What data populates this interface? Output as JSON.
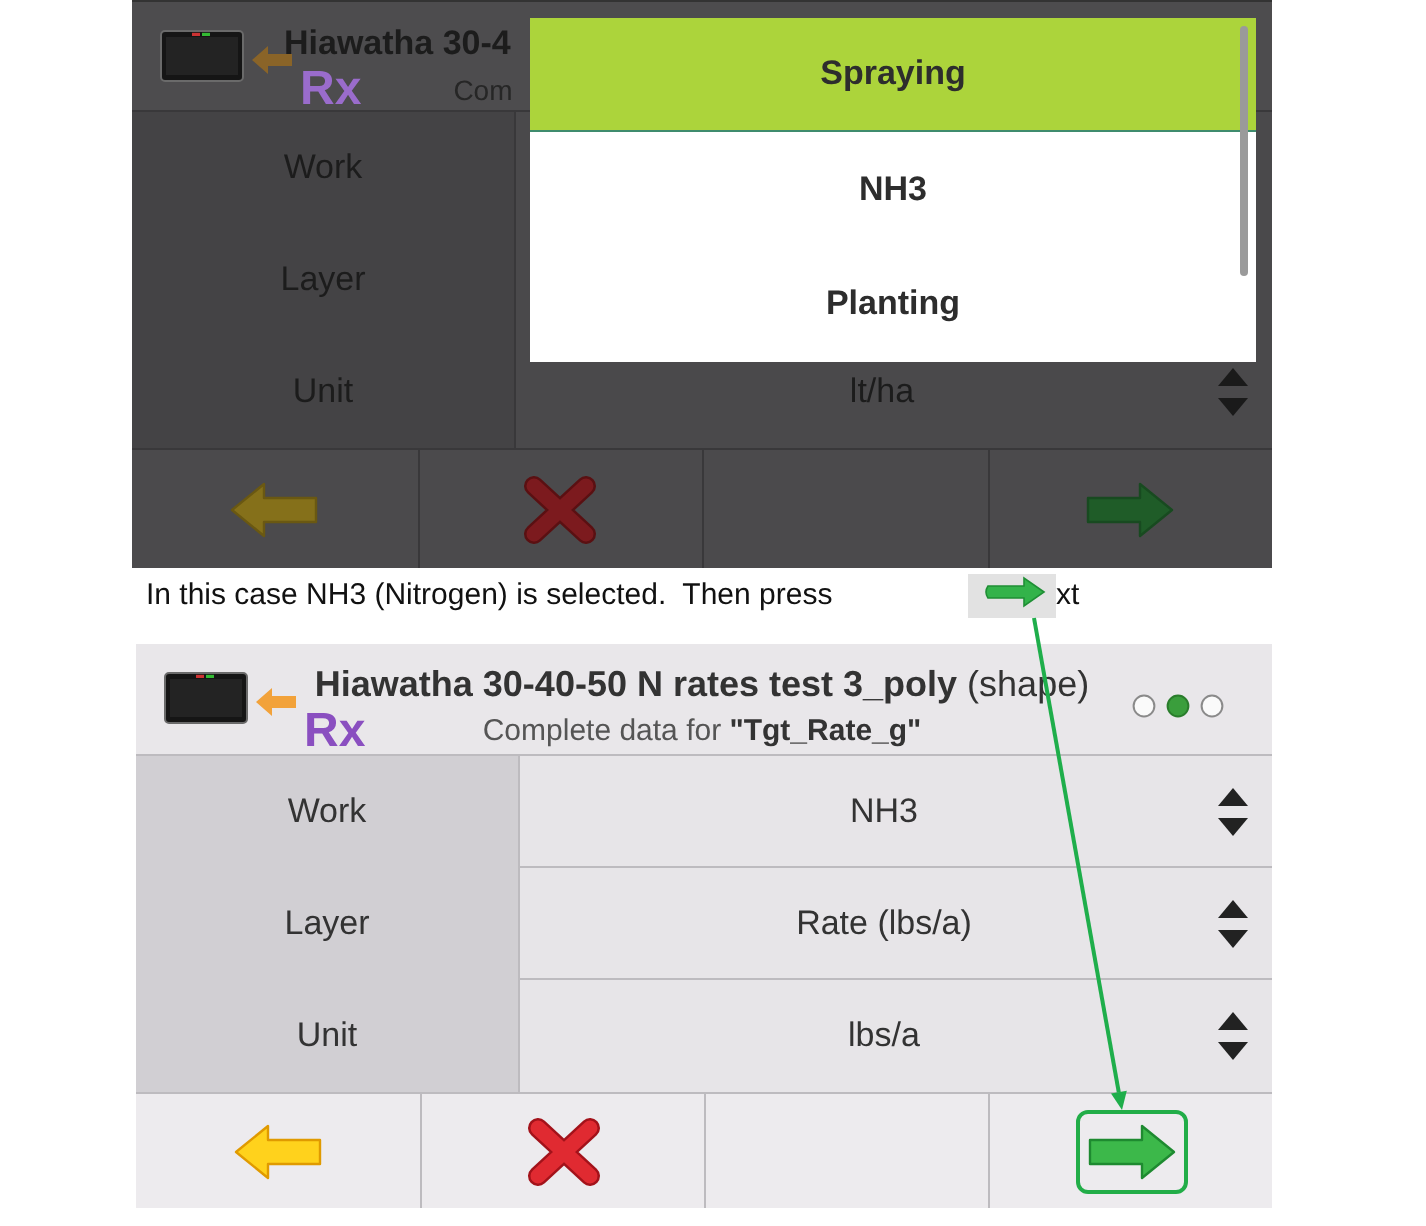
{
  "top_screen": {
    "dimmed": true,
    "header": {
      "logo_text": "Rx",
      "title": "Hiawatha 30-4",
      "subtitle": "Com"
    },
    "fields": [
      {
        "label": "Work"
      },
      {
        "label": "Layer"
      },
      {
        "label": "Unit",
        "value": "lt/ha"
      }
    ],
    "dropdown": {
      "options": [
        {
          "label": "Spraying",
          "selected": true
        },
        {
          "label": "NH3",
          "selected": false
        },
        {
          "label": "Planting",
          "selected": false
        }
      ]
    },
    "toolbar": [
      {
        "kind": "back"
      },
      {
        "kind": "cancel"
      },
      {
        "kind": "empty"
      },
      {
        "kind": "next"
      }
    ]
  },
  "caption": {
    "text": "In this case NH3 (Nitrogen) is selected.  Then press",
    "text_after": "xt"
  },
  "bottom_screen": {
    "dimmed": false,
    "header": {
      "logo_text": "Rx",
      "title": "**Hiawatha 30-40-50 N rates test 3_poly** (shape)",
      "subtitle": "Complete data for **\"Tgt_Rate_g\"**",
      "page_dots": [
        {
          "selected": false
        },
        {
          "selected": true
        },
        {
          "selected": false
        }
      ]
    },
    "fields": [
      {
        "label": "Work",
        "value": "NH3"
      },
      {
        "label": "Layer",
        "value": "Rate (lbs/a)"
      },
      {
        "label": "Unit",
        "value": "lbs/a"
      }
    ],
    "toolbar": [
      {
        "kind": "back",
        "outlined": false
      },
      {
        "kind": "cancel",
        "outlined": false
      },
      {
        "kind": "empty",
        "outlined": false
      },
      {
        "kind": "next",
        "outlined": true
      }
    ]
  }
}
